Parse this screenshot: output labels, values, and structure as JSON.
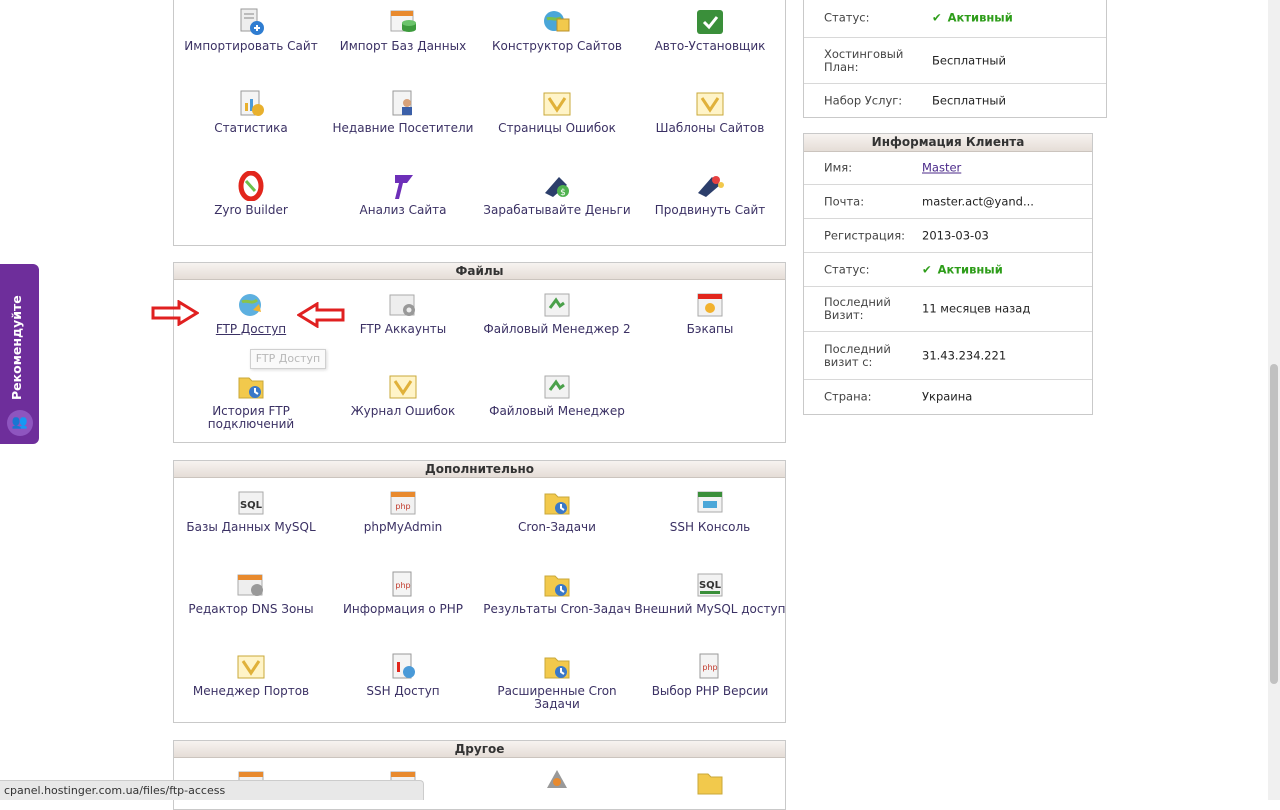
{
  "colors": {
    "accent_purple": "#6e2e9b",
    "status_green": "#2e9d1a",
    "link": "#4b2a8a",
    "label": "#3b3164"
  },
  "top_panel": {
    "items": [
      {
        "label": "Импортировать Сайт",
        "icon": "import-site-icon"
      },
      {
        "label": "Импорт Баз Данных",
        "icon": "import-db-icon"
      },
      {
        "label": "Конструктор Сайтов",
        "icon": "site-builder-icon"
      },
      {
        "label": "Авто-Установщик",
        "icon": "auto-installer-icon"
      },
      {
        "label": "Статистика",
        "icon": "statistics-icon"
      },
      {
        "label": "Недавние Посетители",
        "icon": "recent-visitors-icon"
      },
      {
        "label": "Страницы Ошибок",
        "icon": "error-pages-icon"
      },
      {
        "label": "Шаблоны Сайтов",
        "icon": "site-templates-icon"
      },
      {
        "label": "Zyro Builder",
        "icon": "zyro-icon"
      },
      {
        "label": "Анализ Сайта",
        "icon": "site-analysis-icon"
      },
      {
        "label": "Зарабатывайте Деньги",
        "icon": "earn-money-icon"
      },
      {
        "label": "Продвинуть Сайт",
        "icon": "promote-site-icon"
      }
    ]
  },
  "files_panel": {
    "title": "Файлы",
    "items": [
      {
        "label": "FTP Доступ",
        "icon": "ftp-access-icon"
      },
      {
        "label": "FTP Аккаунты",
        "icon": "ftp-accounts-icon"
      },
      {
        "label": "Файловый Менеджер 2",
        "icon": "file-manager-2-icon"
      },
      {
        "label": "Бэкапы",
        "icon": "backups-icon"
      },
      {
        "label": "История FTP подключений",
        "icon": "ftp-history-icon"
      },
      {
        "label": "Журнал Ошибок",
        "icon": "error-log-icon"
      },
      {
        "label": "Файловый Менеджер",
        "icon": "file-manager-icon"
      }
    ],
    "tooltip": "FTP Доступ"
  },
  "extra_panel": {
    "title": "Дополнительно",
    "items": [
      {
        "label": "Базы Данных MySQL",
        "icon": "mysql-icon"
      },
      {
        "label": "phpMyAdmin",
        "icon": "phpmyadmin-icon"
      },
      {
        "label": "Cron-Задачи",
        "icon": "cron-icon"
      },
      {
        "label": "SSH Консоль",
        "icon": "ssh-console-icon"
      },
      {
        "label": "Редактор DNS Зоны",
        "icon": "dns-editor-icon"
      },
      {
        "label": "Информация о PHP",
        "icon": "php-info-icon"
      },
      {
        "label": "Результаты Cron-Задач",
        "icon": "cron-results-icon"
      },
      {
        "label": "Внешний MySQL доступ",
        "icon": "remote-mysql-icon"
      },
      {
        "label": "Менеджер Портов",
        "icon": "port-manager-icon"
      },
      {
        "label": "SSH Доступ",
        "icon": "ssh-access-icon"
      },
      {
        "label": "Расширенные Cron Задачи",
        "icon": "advanced-cron-icon"
      },
      {
        "label": "Выбор PHP Версии",
        "icon": "php-version-icon"
      }
    ]
  },
  "other_panel": {
    "title": "Другое"
  },
  "hosting_info": {
    "rows": [
      {
        "key": "Статус:",
        "value": "Активный"
      },
      {
        "key": "Хостинговый План:",
        "value": "Бесплатный"
      },
      {
        "key": "Набор Услуг:",
        "value": "Бесплатный"
      }
    ]
  },
  "client_info": {
    "title": "Информация Клиента",
    "rows": [
      {
        "key": "Имя:",
        "value": "Master"
      },
      {
        "key": "Почта:",
        "value": "master.act@yand..."
      },
      {
        "key": "Регистрация:",
        "value": "2013-03-03"
      },
      {
        "key": "Статус:",
        "value": "Активный"
      },
      {
        "key": "Последний Визит:",
        "value": "11 месяцев назад"
      },
      {
        "key": "Последний визит с:",
        "value": "31.43.234.221"
      },
      {
        "key": "Страна:",
        "value": "Украина"
      }
    ]
  },
  "recommend_tab": {
    "label": "Рекомендуйте"
  },
  "status_bar": {
    "url": "cpanel.hostinger.com.ua/files/ftp-access"
  }
}
